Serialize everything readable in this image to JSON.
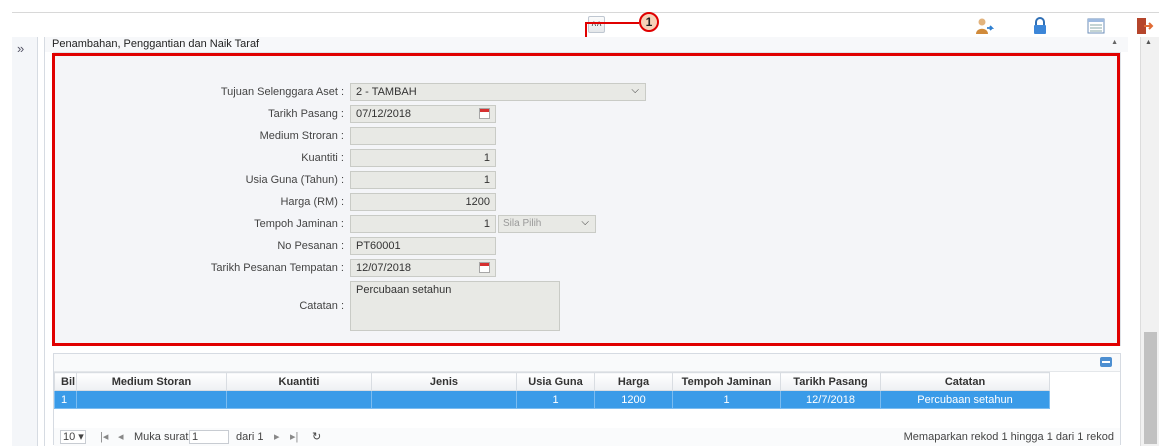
{
  "toolbar": {
    "collapse_icon": "double-chevron-up-icon",
    "callout_number": "1",
    "icons": [
      "user-switch-icon",
      "lock-icon",
      "list-view-icon",
      "logout-icon"
    ]
  },
  "sidebar": {
    "expand_glyph": "»"
  },
  "section": {
    "title": "Penambahan, Penggantian dan Naik Taraf",
    "toggle_glyph": "▲"
  },
  "form": {
    "tujuan_label": "Tujuan Selenggara Aset :",
    "tujuan_value": "2 - TAMBAH",
    "tarikh_pasang_label": "Tarikh Pasang :",
    "tarikh_pasang_value": "07/12/2018",
    "medium_label": "Medium Stroran :",
    "medium_value": "",
    "kuantiti_label": "Kuantiti :",
    "kuantiti_value": "1",
    "usia_label": "Usia Guna (Tahun) :",
    "usia_value": "1",
    "harga_label": "Harga (RM) :",
    "harga_value": "1200",
    "tempoh_label": "Tempoh Jaminan :",
    "tempoh_value": "1",
    "tempoh_unit_placeholder": "Sila Pilih",
    "pesanan_label": "No Pesanan :",
    "pesanan_value": "PT60001",
    "tarikh_pesanan_label": "Tarikh Pesanan Tempatan :",
    "tarikh_pesanan_value": "12/07/2018",
    "catatan_label": "Catatan :",
    "catatan_value": "Percubaan setahun"
  },
  "grid": {
    "columns": [
      "Bil",
      "Medium Storan",
      "Kuantiti",
      "Jenis",
      "Usia Guna",
      "Harga",
      "Tempoh Jaminan",
      "Tarikh Pasang",
      "Catatan"
    ],
    "rows": [
      [
        "1",
        "",
        "",
        "",
        "1",
        "1200",
        "1",
        "12/7/2018",
        "Percubaan setahun"
      ]
    ]
  },
  "pager": {
    "page_size": "10 ▾",
    "first": "|◂",
    "prev": "◂",
    "page_label": "Muka surat",
    "page_value": "1",
    "of_label": "dari 1",
    "next": "▸",
    "last": "▸|",
    "refresh": "↻",
    "summary": "Memaparkan rekod 1 hingga 1 dari 1 rekod"
  }
}
